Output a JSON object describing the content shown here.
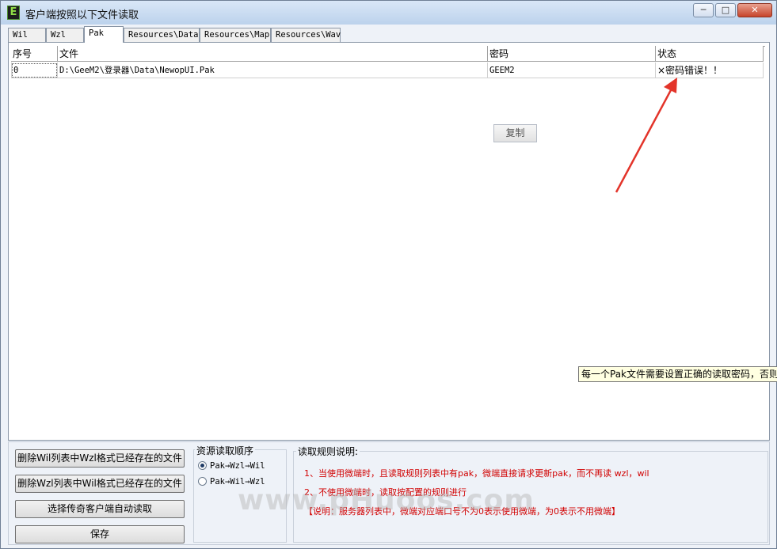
{
  "window": {
    "title": "客户端按照以下文件读取",
    "icon_letter": "E",
    "controls": {
      "minimize": "─",
      "maximize": "□",
      "close": "✕"
    }
  },
  "tabs": [
    {
      "label": "Wil"
    },
    {
      "label": "Wzl"
    },
    {
      "label": "Pak",
      "active": true
    },
    {
      "label": "Resources\\Data"
    },
    {
      "label": "Resources\\Map"
    },
    {
      "label": "Resources\\Wav"
    }
  ],
  "table": {
    "columns": [
      "序号",
      "文件",
      "密码",
      "状态"
    ],
    "rows": [
      [
        "0",
        "D:\\GeeM2\\登录器\\Data\\NewopUI.Pak",
        "GEEM2",
        "×密码错误！！"
      ]
    ]
  },
  "copy_button": "复制",
  "tooltip": "每一个Pak文件需要设置正确的读取密码，否则",
  "buttons": {
    "delete_wil": "删除Wil列表中Wzl格式已经存在的文件",
    "delete_wzl": "删除Wzl列表中Wil格式已经存在的文件",
    "auto_read": "选择传奇客户端自动读取",
    "save": "保存"
  },
  "resource_order": {
    "title": "资源读取顺序",
    "options": [
      {
        "label": "Pak→Wzl→Wil",
        "selected": true
      },
      {
        "label": "Pak→Wil→Wzl",
        "selected": false
      }
    ]
  },
  "rules": {
    "title": "读取规则说明:",
    "lines": [
      "1、当使用微端时，且读取规则列表中有pak，微端直接请求更新pak，而不再读 wzl，wil",
      "2、不使用微端时，读取按配置的规则进行",
      "【说明：服务器列表中，微端对应端口号不为0表示使用微端，为0表示不用微端】"
    ]
  },
  "watermark": "www.pHuoos.com",
  "colors": {
    "rule_text": "#d10000",
    "annotation_arrow": "#e3342a",
    "tooltip_bg": "#ffffe1"
  }
}
